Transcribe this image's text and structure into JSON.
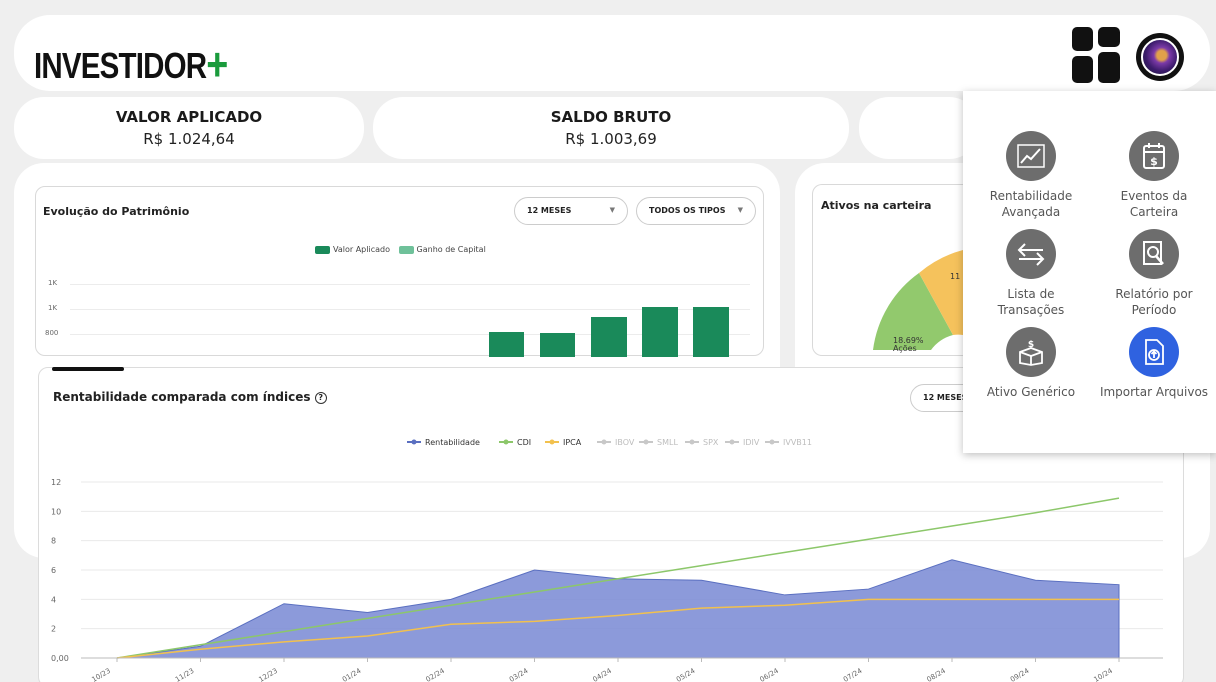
{
  "brand": {
    "name": "INVESTIDOR",
    "plus": "+"
  },
  "summary": [
    {
      "title": "VALOR APLICADO",
      "value": "R$ 1.024,64"
    },
    {
      "title": "SALDO BRUTO",
      "value": "R$ 1.003,69"
    }
  ],
  "evolucao": {
    "title": "Evolução do Patrimônio",
    "period": "12 MESES",
    "type": "TODOS OS TIPOS",
    "legend": [
      "Valor Aplicado",
      "Ganho de Capital"
    ],
    "y_ticks": [
      "1K",
      "1K",
      "800"
    ],
    "bars": [
      820,
      810,
      940,
      1020,
      1020
    ]
  },
  "ativos": {
    "title": "Ativos na carteira",
    "slice_label": "18.69%",
    "slice_name": "Ações",
    "slice_partial": "11"
  },
  "rentabilidade": {
    "title": "Rentabilidade comparada com índices",
    "help": "?",
    "period": "12 MESES"
  },
  "chart_data": {
    "type": "line",
    "x": [
      "10/23",
      "11/23",
      "12/23",
      "01/24",
      "02/24",
      "03/24",
      "04/24",
      "05/24",
      "06/24",
      "07/24",
      "08/24",
      "09/24",
      "10/24"
    ],
    "y_ticks": [
      "0,00",
      "2",
      "4",
      "6",
      "8",
      "10",
      "12"
    ],
    "ylim": [
      0,
      12
    ],
    "legend": [
      "Rentabilidade",
      "CDI",
      "IPCA",
      "IBOV",
      "SMLL",
      "SPX",
      "IDIV",
      "IVVB11"
    ],
    "series": [
      {
        "name": "Rentabilidade",
        "color": "#5a6fc0",
        "values": [
          0,
          0.8,
          3.7,
          3.1,
          4.0,
          6.0,
          5.4,
          5.3,
          4.3,
          4.7,
          6.7,
          5.3,
          5.0
        ]
      },
      {
        "name": "CDI",
        "color": "#8cc76a",
        "values": [
          0,
          0.9,
          1.8,
          2.7,
          3.6,
          4.5,
          5.4,
          6.3,
          7.2,
          8.1,
          9.0,
          9.9,
          10.9
        ]
      },
      {
        "name": "IPCA",
        "color": "#f2c14e",
        "values": [
          0,
          0.6,
          1.1,
          1.5,
          2.3,
          2.5,
          2.9,
          3.4,
          3.6,
          4.0,
          4.0,
          4.0,
          4.0
        ]
      }
    ]
  },
  "menu": {
    "items": [
      {
        "label": "Rentabilidade Avançada",
        "icon": "chart-icon"
      },
      {
        "label": "Eventos da Carteira",
        "icon": "calendar-icon"
      },
      {
        "label": "Lista de Transações",
        "icon": "transfer-icon"
      },
      {
        "label": "Relatório por Período",
        "icon": "report-icon"
      },
      {
        "label": "Ativo Genérico",
        "icon": "box-icon"
      },
      {
        "label": "Importar Arquivos",
        "icon": "upload-icon"
      }
    ]
  }
}
